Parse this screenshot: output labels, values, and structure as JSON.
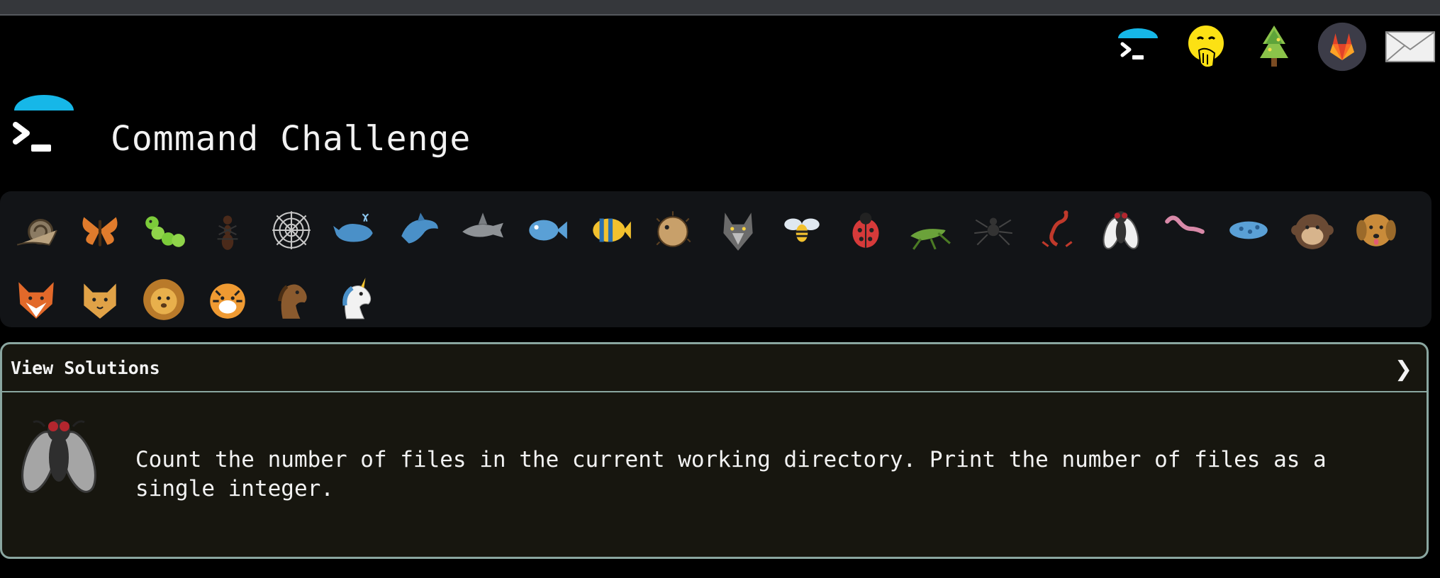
{
  "app": {
    "title": "Command Challenge"
  },
  "topnav": {
    "items": [
      {
        "icon": "terminal-logo-icon",
        "name": "home"
      },
      {
        "icon": "face-with-hand-over-mouth-icon",
        "name": "emoji"
      },
      {
        "icon": "tree-icon",
        "name": "tree"
      },
      {
        "icon": "gitlab-icon",
        "name": "gitlab"
      },
      {
        "icon": "envelope-icon",
        "name": "mail"
      }
    ]
  },
  "animals": [
    "snail",
    "butterfly",
    "caterpillar",
    "ant",
    "spider-web",
    "whale",
    "dolphin",
    "shark",
    "fish",
    "tropical-fish",
    "blowfish",
    "wolf",
    "honeybee",
    "ladybug",
    "cricket",
    "spider",
    "scorpion",
    "fly",
    "worm",
    "microbe",
    "monkey",
    "dog",
    "fox",
    "cat",
    "lion",
    "tiger",
    "horse",
    "unicorn"
  ],
  "solutions": {
    "label": "View Solutions",
    "chevron": "❯"
  },
  "challenge": {
    "icon": "fly-icon",
    "text": "Count the number of files in the current working directory. Print the number of files as a single integer."
  },
  "colors": {
    "accent": "#16b7e8",
    "card_border": "#8aa6a0",
    "card_bg": "#17160f",
    "panel_bg": "#121417"
  }
}
